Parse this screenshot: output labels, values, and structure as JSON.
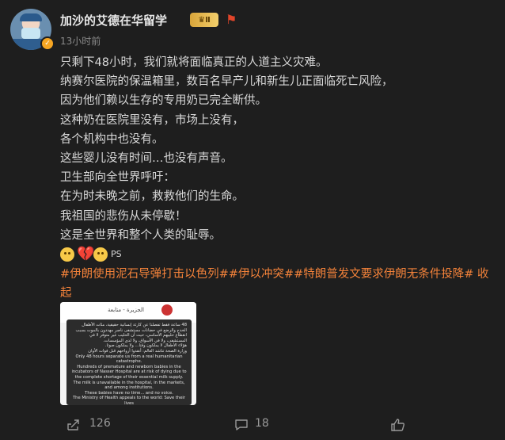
{
  "post": {
    "author": "加沙的艾德在华留学",
    "level_badge": "Ⅱ",
    "time": "13小时前",
    "lines": [
      "只剩下48小时，我们就将面临真正的人道主义灾难。",
      "纳赛尔医院的保温箱里，数百名早产儿和新生儿正面临死亡风险，",
      "因为他们赖以生存的专用奶已完全断供。",
      "这种奶在医院里没有，市场上没有，",
      "各个机构中也没有。",
      "这些婴儿没有时间…也没有声音。",
      "卫生部向全世界呼吁：",
      "在为时未晚之前，救救他们的生命。",
      "我祖国的悲伤从未停歇！",
      "这是全世界和整个人类的耻辱。"
    ],
    "emoji_suffix": "PS",
    "tags": "#伊朗使用泥石导弹打击以色列##伊以冲突##特朗普发文要求伊朗无条件投降#",
    "collapse_label": "收起",
    "icons": {
      "verify": "verified-badge-icon",
      "crown": "vip-crown-badge-icon",
      "flag": "red-flag-icon",
      "emoji1": "sad-face-emoji-icon",
      "emoji2": "broken-heart-emoji-icon",
      "emoji3": "sad-face-emoji-icon"
    }
  },
  "image": {
    "header_text": "الجزيرة - متابعة",
    "paragraphs_ar": [
      "48 ساعة فقط تفصلنا عن كارثة إنسانية حقيقية، مئات الأطفال الخدج والرضع في حضانات مستشفى ناصر مهددون بالموت بسبب انقطاع حليبهم الأساسي، حيث أن الحليب غير متوفر لا في المستشفى، ولا في الأسواق، ولا لدى المؤسسات.",
      "هؤلاء الأطفال لا يملكون وقتا... ولا يملكون صوتا.",
      "وزارة الصحة تناشد العالم: أنقذوا أرواحهم قبل فوات الأوان"
    ],
    "paragraphs_en": [
      "Only 48 hours separate us from a real humanitarian catastrophe.",
      "Hundreds of premature and newborn babies in the incubators of Nasser Hospital are at risk of dying due to the complete shortage of their essential milk supply.",
      "The milk is unavailable in the hospital, in the markets, and among institutions.",
      "These babies have no time... and no voice.",
      "The Ministry of Health appeals to the world: Save their lives"
    ]
  },
  "footer": {
    "share_count": "126",
    "comment_count": "18",
    "icons": {
      "share": "share-icon",
      "comment": "comment-icon",
      "like": "like-icon"
    }
  }
}
